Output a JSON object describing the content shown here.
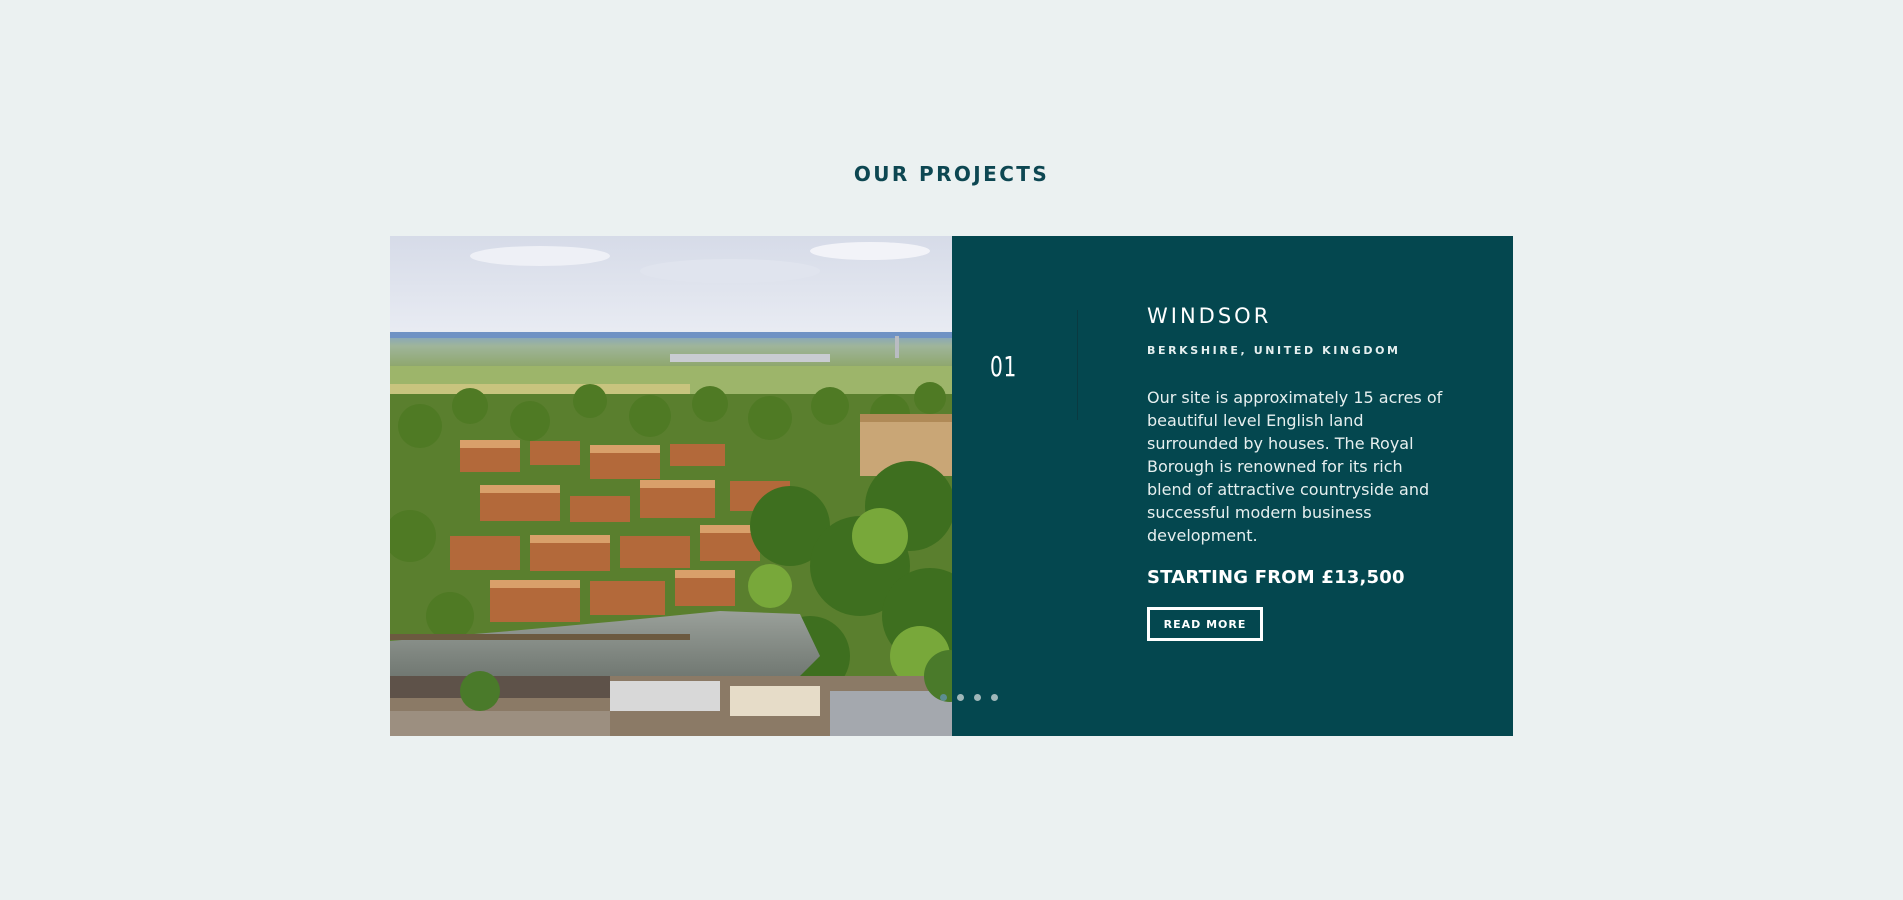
{
  "section": {
    "title": "OUR PROJECTS"
  },
  "project": {
    "number": "01",
    "title": "WINDSOR",
    "location": "BERKSHIRE, UNITED KINGDOM",
    "description": "Our site is approximately 15 acres of beautiful level English land surrounded by houses. The Royal Borough is renowned for its rich blend of attractive countryside and successful modern business development.",
    "price": "STARTING FROM £13,500",
    "cta_label": "READ MORE",
    "image_subject": "aerial view of Windsor town and river"
  },
  "slider": {
    "dot_count": 4,
    "active_index": 0
  },
  "colors": {
    "background": "#ebf1f1",
    "accent": "#04474f",
    "heading": "#0d4752"
  }
}
